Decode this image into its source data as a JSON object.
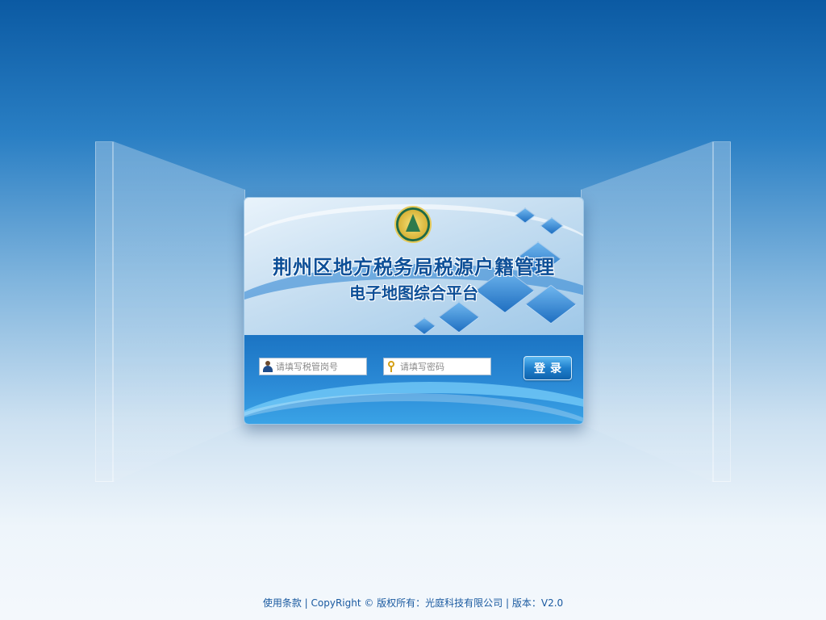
{
  "banner": {
    "title_main": "荆州区地方税务局税源户籍管理",
    "title_sub": "电子地图综合平台"
  },
  "form": {
    "username_placeholder": "请填写税管岗号",
    "password_placeholder": "请填写密码",
    "login_label": "登录"
  },
  "footer": {
    "text": "使用条款 | CopyRight © 版权所有：光庭科技有限公司 | 版本：V2.0"
  },
  "icons": {
    "user": "user-icon",
    "password": "key-icon",
    "emblem": "tax-emblem-logo"
  },
  "colors": {
    "accent": "#1f7fcc",
    "title": "#0d4f97",
    "footer": "#1a5aa0"
  }
}
